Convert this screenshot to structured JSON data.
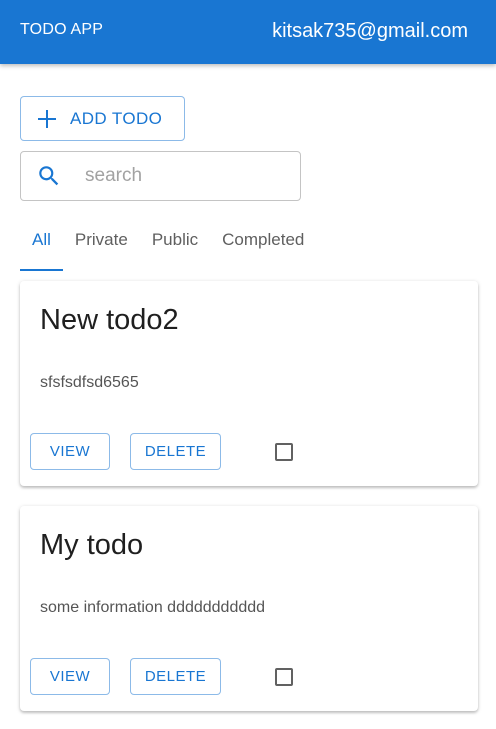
{
  "appbar": {
    "title": "TODO APP",
    "user_email": "kitsak735@gmail.com"
  },
  "toolbar": {
    "add_label": "ADD TODO",
    "add_icon": "plus-icon"
  },
  "search": {
    "placeholder": "search",
    "value": "",
    "icon": "search-icon"
  },
  "tabs": [
    {
      "label": "All",
      "active": true
    },
    {
      "label": "Private",
      "active": false
    },
    {
      "label": "Public",
      "active": false
    },
    {
      "label": "Completed",
      "active": false
    }
  ],
  "todos": [
    {
      "title": "New todo2",
      "description": "sfsfsdfsd6565",
      "view_label": "VIEW",
      "delete_label": "DELETE",
      "completed": false
    },
    {
      "title": "My todo",
      "description": "some information ddddddddddd",
      "view_label": "VIEW",
      "delete_label": "DELETE",
      "completed": false
    }
  ],
  "colors": {
    "primary": "#1976d2",
    "text": "#1f1f1f",
    "muted": "#5f5f5f"
  }
}
